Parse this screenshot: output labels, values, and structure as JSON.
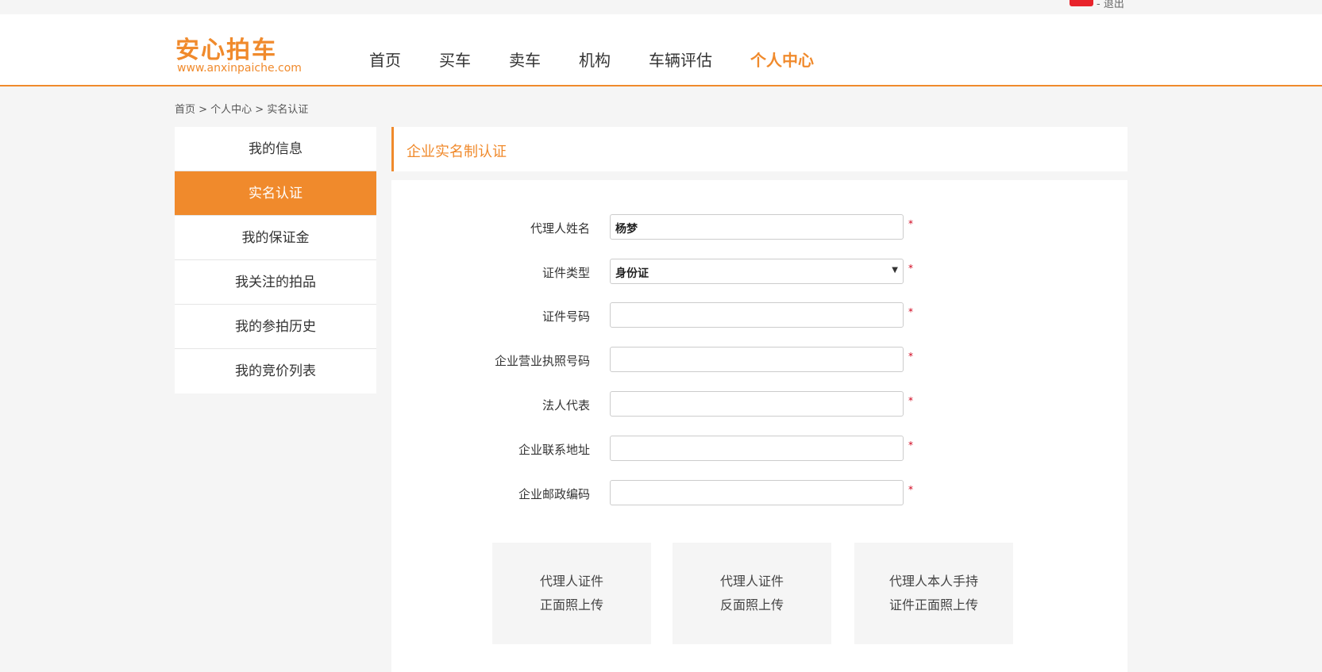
{
  "topbar": {
    "user_redacted": "",
    "logout": "- 退出"
  },
  "logo": {
    "name": "安心拍车",
    "url": "www.anxinpaiche.com"
  },
  "nav": [
    "首页",
    "买车",
    "卖车",
    "机构",
    "车辆评估",
    "个人中心"
  ],
  "breadcrumb": "首页 > 个人中心 > 实名认证",
  "sidebar": [
    "我的信息",
    "实名认证",
    "我的保证金",
    "我关注的拍品",
    "我的参拍历史",
    "我的竞价列表"
  ],
  "title": "企业实名制认证",
  "form": {
    "required_mark": "*",
    "fields": [
      {
        "label": "代理人姓名",
        "value": "杨梦"
      },
      {
        "label": "证件类型",
        "value": "身份证"
      },
      {
        "label": "证件号码",
        "value": ""
      },
      {
        "label": "企业营业执照号码",
        "value": ""
      },
      {
        "label": "法人代表",
        "value": ""
      },
      {
        "label": "企业联系地址",
        "value": ""
      },
      {
        "label": "企业邮政编码",
        "value": ""
      }
    ]
  },
  "uploads": [
    {
      "line1": "代理人证件",
      "line2": "正面照上传"
    },
    {
      "line1": "代理人证件",
      "line2": "反面照上传"
    },
    {
      "line1": "代理人本人手持",
      "line2": "证件正面照上传"
    }
  ],
  "colors": {
    "accent": "#f08a2c",
    "required": "#d0021b",
    "background": "#f5f5f5"
  }
}
